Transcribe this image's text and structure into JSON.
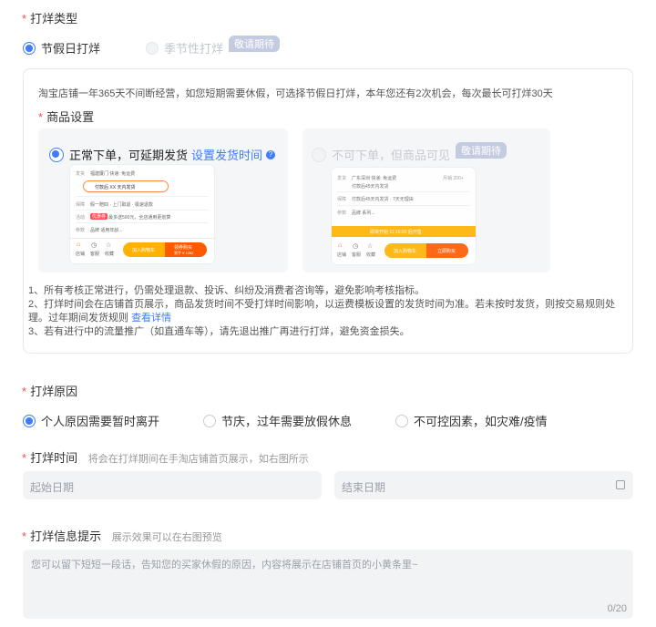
{
  "type_section": {
    "label": "打烊类型",
    "option_holiday": "节假日打烊",
    "option_season": "季节性打烊",
    "season_badge": "敬请期待"
  },
  "settings_box": {
    "intro": "淘宝店铺一年365天不间断经营，如您短期需要休假，可选择节假日打烊，本年您还有2次机会，每次最长可打烊30天",
    "goods_label": "商品设置",
    "card_left": {
      "title": "正常下单，可延期发货",
      "link": "设置发货时间",
      "mock": {
        "row1_key": "发货",
        "row1_val": "福建厦门  快递: 免运费",
        "pill": "付款后 XX 天内发货",
        "row2_key": "保障",
        "row2_val": "假一赔四 · 上门取退 · 极速退款",
        "row3_key": "活动",
        "row3_tag": "优惠券",
        "row3_val": "最多送500元，全店通用更划算",
        "row4_key": "参数",
        "row4_val": "品牌 适用年龄...",
        "nav1": "店铺",
        "nav2": "客服",
        "nav3": "收藏",
        "btn_cart": "加入购物车",
        "btn_buy": "领券购买",
        "btn_buy_sub": "到手 ¥ 1262"
      }
    },
    "card_right": {
      "title": "不可下单，但商品可见",
      "badge": "敬请期待",
      "mock": {
        "row1_key": "发货",
        "row1_val": "广东深圳  快递: 免运费",
        "row1_extra": "月销 200+",
        "row1_sub": "付款后45天内发货",
        "row2_key": "保障",
        "row2_val": "付款后45天内发货 · 7天无理由",
        "row3_key": "参数",
        "row3_val": "品牌 系列...",
        "banner": "即将开始  11:16:00 后开售",
        "nav1": "店铺",
        "nav2": "客服",
        "nav3": "收藏",
        "btn_cart": "加入购物车",
        "btn_buy": "立即购买"
      }
    },
    "notes": {
      "n1": "1、所有考核正常进行，仍需处理退款、投诉、纠纷及消费者咨询等，避免影响考核指标。",
      "n2": "2、打烊时间会在店铺首页展示，商品发货时间不受打烊时间影响，以运费模板设置的发货时间为准。若未按时发货，则按交易规则处理。过年期间发货规则",
      "n2_link": "查看详情",
      "n3": "3、若有进行中的流量推广（如直通车等），请先退出推广再进行打烊，避免资金损失。"
    }
  },
  "reason_section": {
    "label": "打烊原因",
    "opt1": "个人原因需要暂时离开",
    "opt2": "节庆，过年需要放假休息",
    "opt3": "不可控因素，如灾难/疫情"
  },
  "time_section": {
    "label": "打烊时间",
    "hint": "将会在打烊期间在手淘店铺首页展示，如右图所示",
    "start_placeholder": "起始日期",
    "end_placeholder": "结束日期"
  },
  "info_section": {
    "label": "打烊信息提示",
    "hint": "展示效果可以在右图预览",
    "placeholder": "您可以留下短短一段话，告知您的买家休假的原因，内容将展示在店铺首页的小黄条里~",
    "counter": "0/20"
  }
}
